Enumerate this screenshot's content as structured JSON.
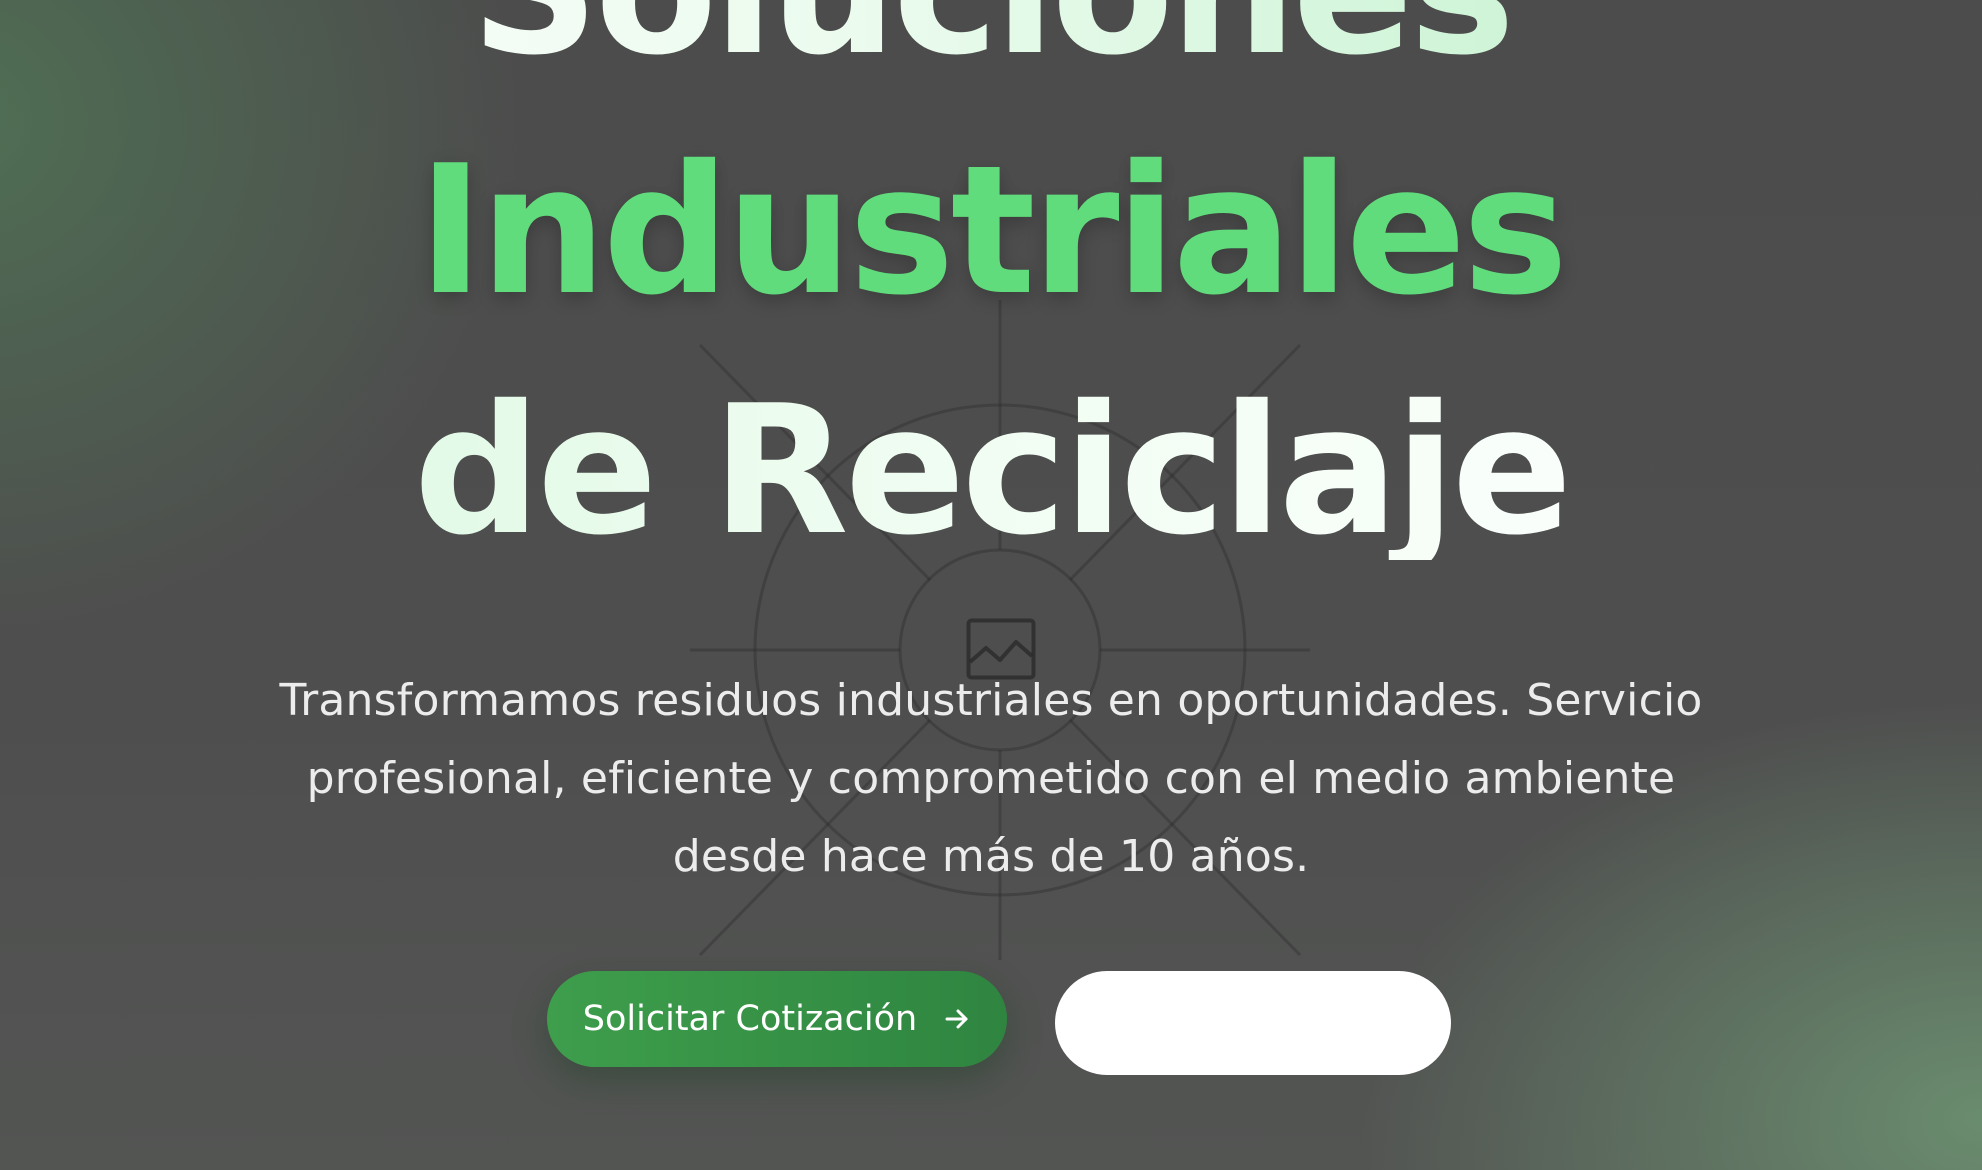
{
  "hero": {
    "headline_line_1": "Soluciones",
    "headline_line_2": "Industriales",
    "headline_line_3": "de Reciclaje",
    "subtitle": "Transformamos residuos industriales en oportunidades. Servicio profesional, eficiente y comprometido con el medio ambiente desde hace más de 10 años.",
    "broken_image_icon": "broken-image-icon",
    "primary_cta": {
      "label": "Solicitar Cotización",
      "icon": "arrow-right-icon"
    },
    "secondary_cta": {
      "label": ""
    }
  },
  "colors": {
    "background": "#4e4e4e",
    "accent_green": "#60dc7c",
    "button_green": "#3e9e4c",
    "headline_white": "#ffffff",
    "subtitle_text": "#ececec"
  }
}
